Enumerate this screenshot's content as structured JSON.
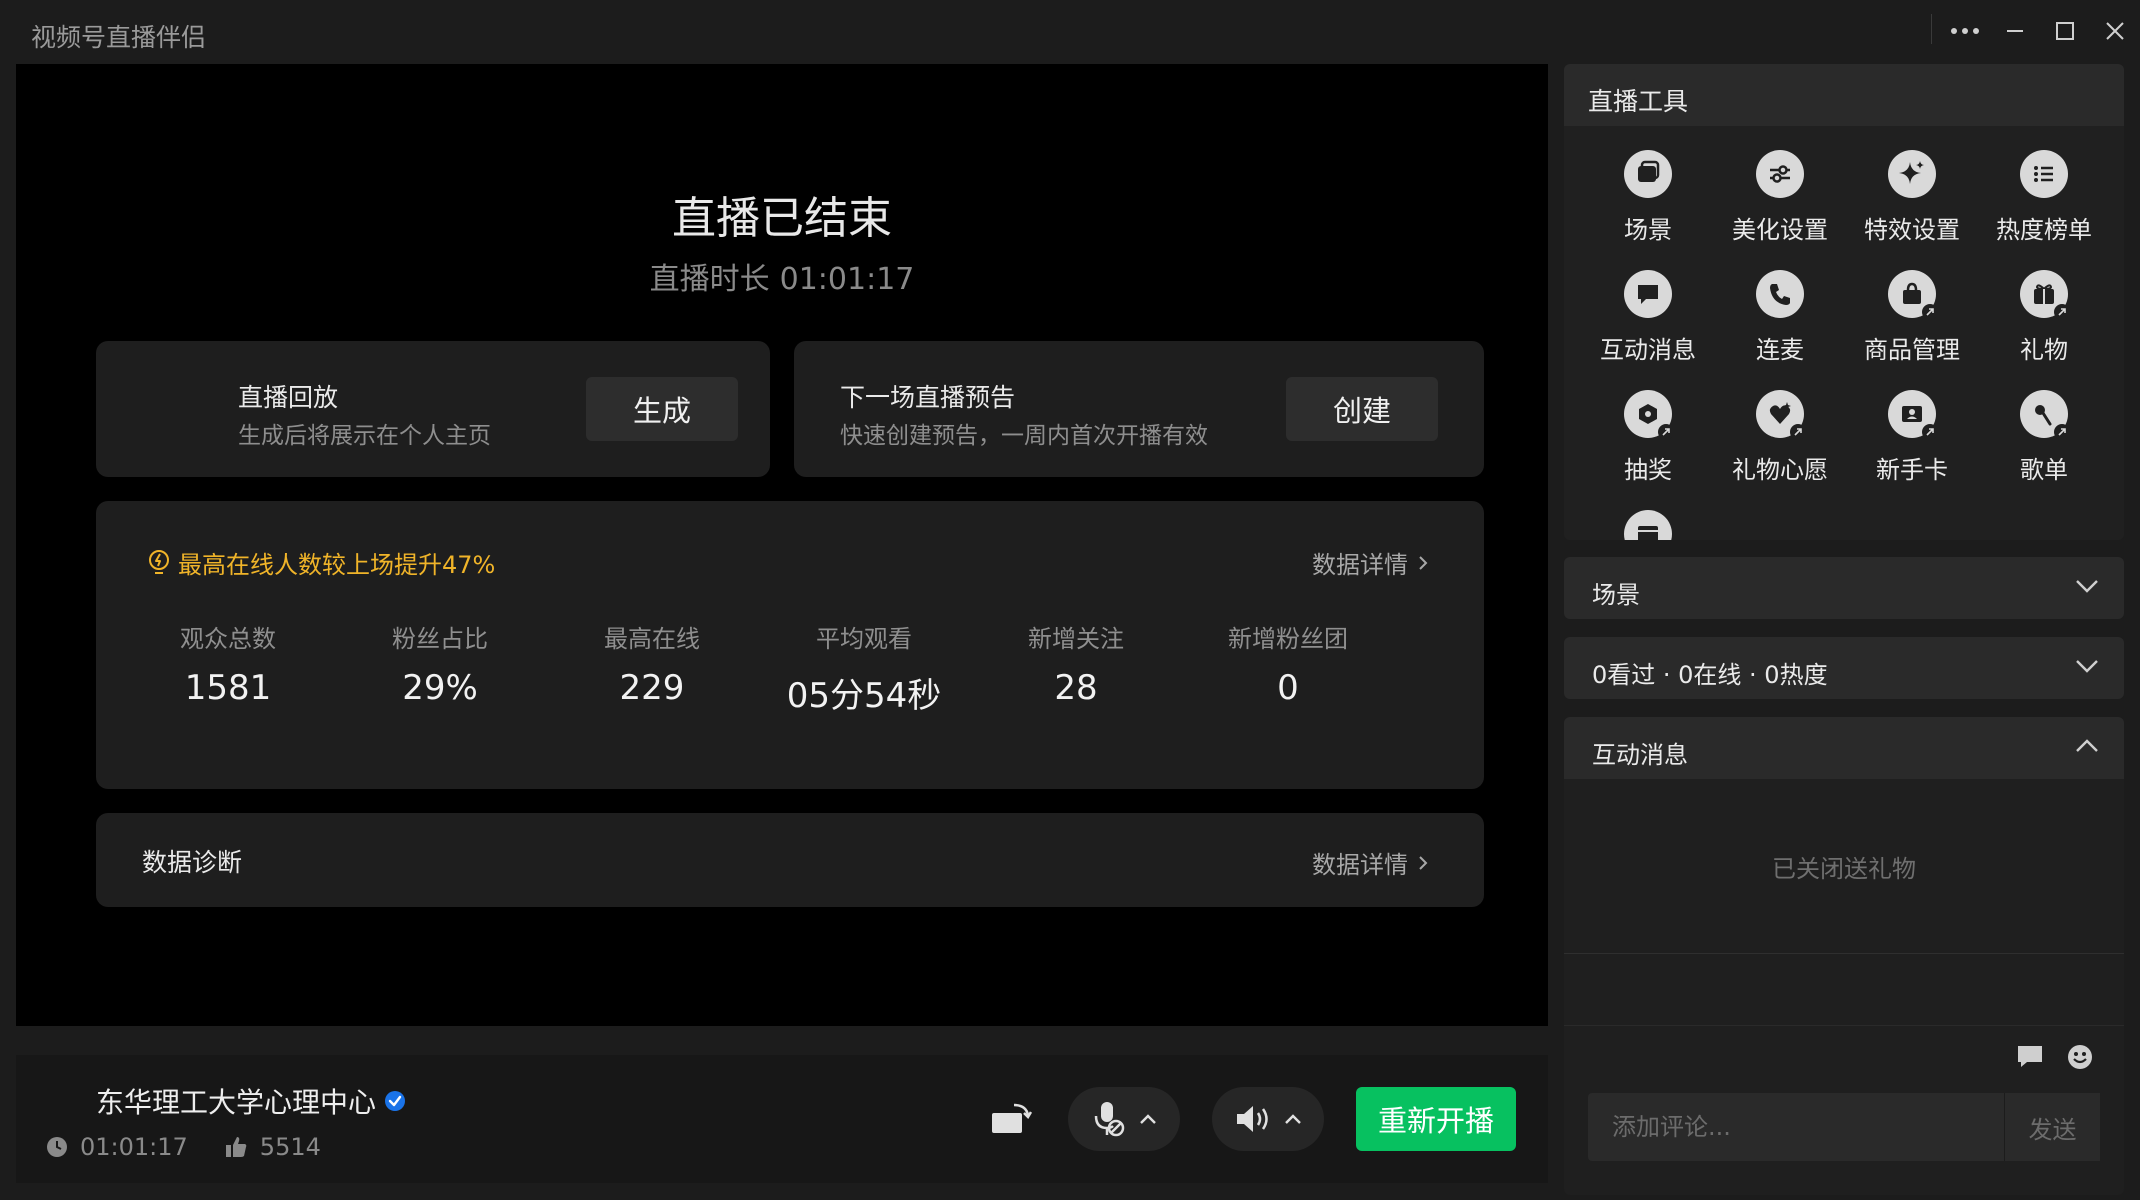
{
  "window": {
    "title": "视频号直播伴侣",
    "icons": [
      "more-icon",
      "minimize-icon",
      "maximize-icon",
      "close-icon"
    ]
  },
  "stage": {
    "end_title": "直播已结束",
    "duration_label": "直播时长",
    "duration_value": "01:01:17",
    "replay": {
      "title": "直播回放",
      "subtitle": "生成后将展示在个人主页",
      "button": "生成"
    },
    "preview": {
      "title": "下一场直播预告",
      "subtitle": "快速创建预告，一周内首次开播有效",
      "button": "创建"
    },
    "stats": {
      "highlight": "最高在线人数较上场提升47%",
      "detail_link": "数据详情",
      "items": [
        {
          "label": "观众总数",
          "value": "1581"
        },
        {
          "label": "粉丝占比",
          "value": "29%"
        },
        {
          "label": "最高在线",
          "value": "229"
        },
        {
          "label": "平均观看",
          "value": "05分54秒"
        },
        {
          "label": "新增关注",
          "value": "28"
        },
        {
          "label": "新增粉丝团",
          "value": "0"
        }
      ]
    },
    "diagnosis": {
      "title": "数据诊断",
      "detail_link": "数据详情"
    }
  },
  "bottom": {
    "channel_name": "东华理工大学心理中心",
    "elapsed": "01:01:17",
    "likes": "5514",
    "restart_button": "重新开播"
  },
  "tools": {
    "header": "直播工具",
    "items": [
      {
        "label": "场景",
        "icon": "scene-icon"
      },
      {
        "label": "美化设置",
        "icon": "beauty-sliders-icon"
      },
      {
        "label": "特效设置",
        "icon": "sparkle-icon"
      },
      {
        "label": "热度榜单",
        "icon": "list-icon"
      },
      {
        "label": "互动消息",
        "icon": "chat-icon"
      },
      {
        "label": "连麦",
        "icon": "phone-icon"
      },
      {
        "label": "商品管理",
        "icon": "shopping-bag-icon"
      },
      {
        "label": "礼物",
        "icon": "gift-icon"
      },
      {
        "label": "抽奖",
        "icon": "lottery-icon"
      },
      {
        "label": "礼物心愿",
        "icon": "gift-wish-icon"
      },
      {
        "label": "新手卡",
        "icon": "newbie-card-icon"
      },
      {
        "label": "歌单",
        "icon": "music-note-icon"
      }
    ]
  },
  "panels": {
    "scene": "场景",
    "views": "0看过 · 0在线 · 0热度",
    "interact": {
      "header": "互动消息",
      "gift_off": "已关闭送礼物",
      "comment_placeholder": "添加评论...",
      "send_button": "发送"
    }
  },
  "colors": {
    "accent_green": "#07c160",
    "highlight_orange": "#f0b429",
    "verified_blue": "#1a73e8"
  }
}
